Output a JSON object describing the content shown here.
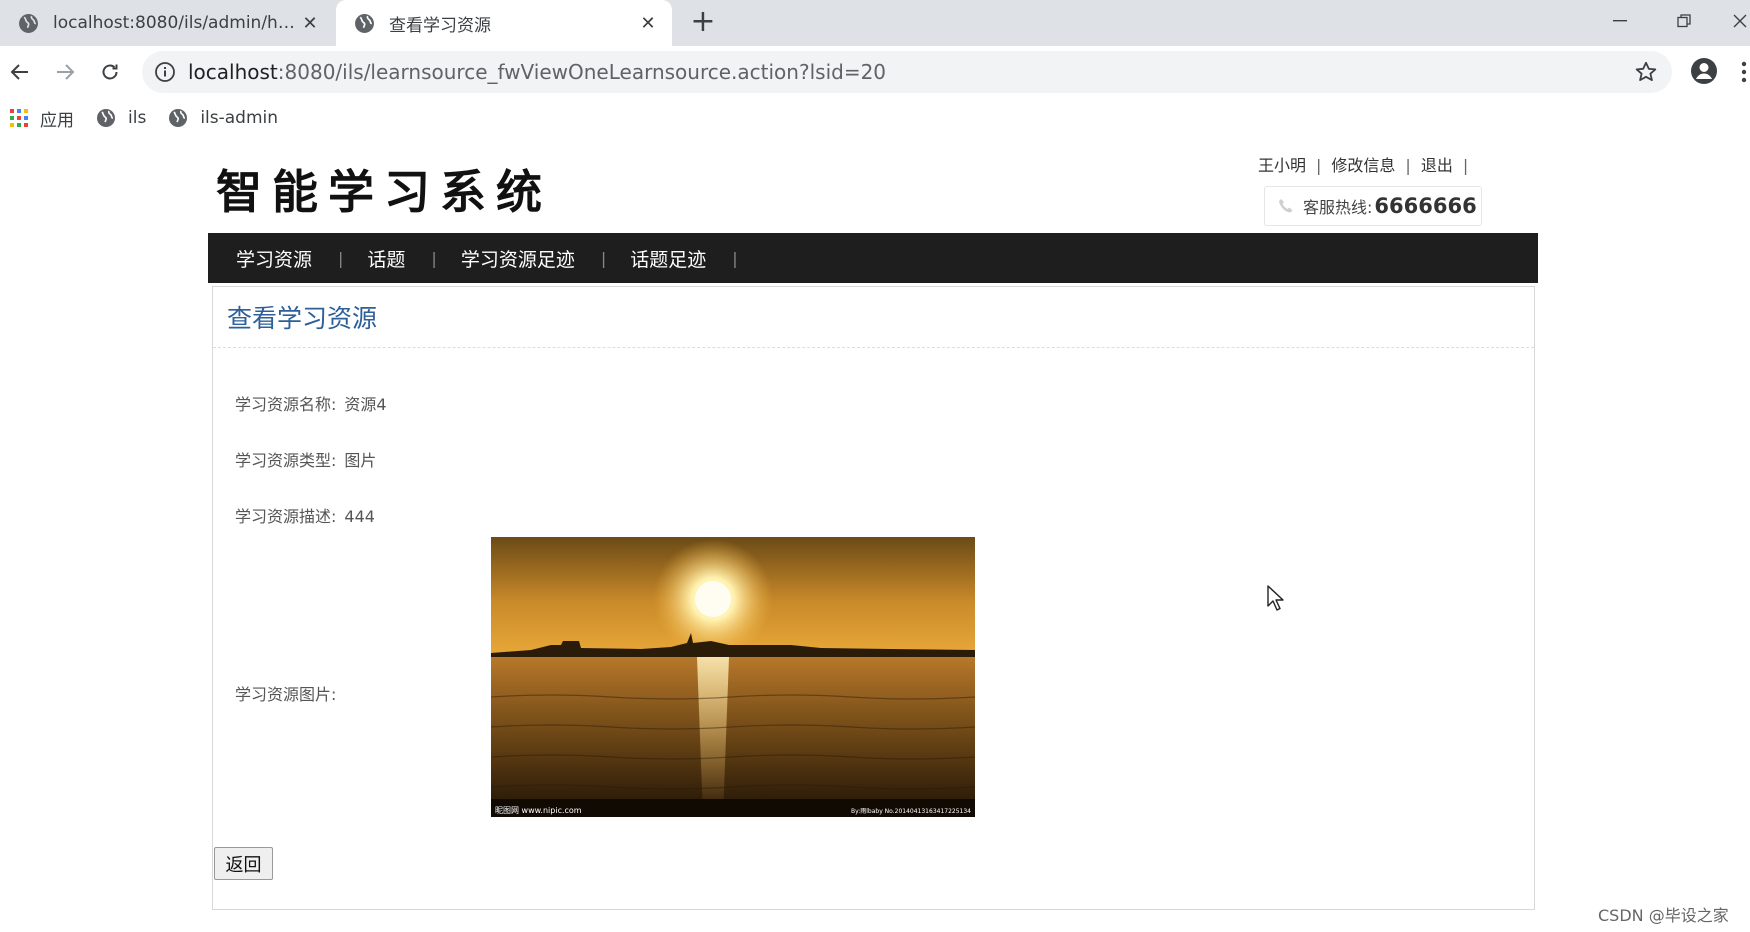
{
  "browser": {
    "tabs": [
      {
        "title": "localhost:8080/ils/admin/home...",
        "active": false
      },
      {
        "title": "查看学习资源",
        "active": true
      }
    ],
    "url_host": "localhost",
    "url_path": ":8080/ils/learnsource_fwViewOneLearnsource.action?lsid=20",
    "bookmarks": [
      {
        "label": "应用",
        "icon": "apps-grid-icon"
      },
      {
        "label": "ils",
        "icon": "globe-icon"
      },
      {
        "label": "ils-admin",
        "icon": "globe-icon"
      }
    ]
  },
  "site": {
    "logo": "智能学习系统",
    "user_name": "王小明",
    "edit_info": "修改信息",
    "logout": "退出",
    "hotline_label": "客服热线:",
    "hotline_number": "6666666",
    "nav": [
      "学习资源",
      "话题",
      "学习资源足迹",
      "话题足迹"
    ]
  },
  "content": {
    "heading": "查看学习资源",
    "fields": {
      "name_label": "学习资源名称:",
      "name_value": "资源4",
      "type_label": "学习资源类型:",
      "type_value": "图片",
      "desc_label": "学习资源描述:",
      "desc_value": "444",
      "image_label": "学习资源图片:"
    },
    "image_caption_left": "昵图网 www.nipic.com",
    "image_caption_right": "By:雨lbaby No.20140413163417225134",
    "back_button": "返回"
  },
  "watermark": "CSDN @毕设之家",
  "colors": {
    "nav_bg": "#1e1e1e",
    "heading": "#2d5f9a",
    "tab_bar": "#dee1e6"
  }
}
